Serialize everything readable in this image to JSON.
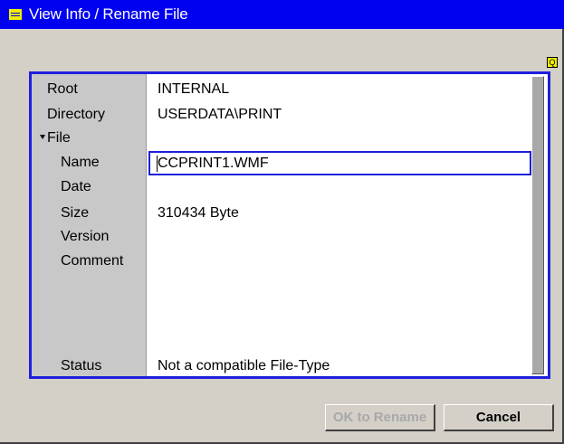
{
  "window": {
    "title": "View Info / Rename File"
  },
  "labels": {
    "root": "Root",
    "directory": "Directory",
    "file": "File",
    "name": "Name",
    "date": "Date",
    "size": "Size",
    "version": "Version",
    "comment": "Comment",
    "status": "Status"
  },
  "values": {
    "root": "INTERNAL",
    "directory": "USERDATA\\PRINT",
    "name": "CCPRINT1.WMF",
    "date": "",
    "size": "310434 Byte",
    "version": "",
    "comment": "",
    "status": "Not a compatible File-Type"
  },
  "buttons": {
    "ok": "OK to Rename",
    "cancel": "Cancel",
    "corner": "Q"
  },
  "colors": {
    "titlebar": "#0000f0",
    "accent_border": "#1f1fdc",
    "icon_yellow": "#f0f000"
  },
  "icons": {
    "title": "window-menu-icon",
    "corner": "zoom-icon",
    "file_expander": "triangle-down-icon"
  }
}
